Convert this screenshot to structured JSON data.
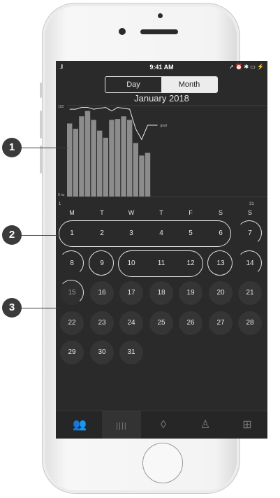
{
  "status": {
    "time": "9:41 AM",
    "signal": "..ll",
    "indicators": "➚ ⏰ ✱ ▭ ⚡"
  },
  "segment": {
    "day": "Day",
    "month": "Month",
    "selected": "Month"
  },
  "month_title": "January 2018",
  "chart_data": {
    "type": "bar",
    "categories": [
      "1",
      "2",
      "3",
      "4",
      "5",
      "6",
      "7",
      "8",
      "9",
      "10",
      "11",
      "12",
      "13",
      "14",
      "15"
    ],
    "values": [
      82,
      76,
      90,
      96,
      86,
      74,
      66,
      86,
      87,
      90,
      86,
      60,
      46,
      49,
      0
    ],
    "goal_line": [
      98,
      98,
      100,
      100,
      98,
      99,
      100,
      96,
      100,
      99,
      98,
      76,
      64,
      80
    ],
    "ylim": [
      0,
      102
    ],
    "ytick_top": "102",
    "ytick_bottom": "0 oz",
    "xtick_first": "1",
    "xtick_last": "31",
    "goal_label": "goal"
  },
  "weekdays": [
    "M",
    "T",
    "W",
    "T",
    "F",
    "S",
    "S"
  ],
  "calendar": [
    [
      "1",
      "2",
      "3",
      "4",
      "5",
      "6",
      "7"
    ],
    [
      "8",
      "9",
      "10",
      "11",
      "12",
      "13",
      "14"
    ],
    [
      "15",
      "16",
      "17",
      "18",
      "19",
      "20",
      "21"
    ],
    [
      "22",
      "23",
      "24",
      "25",
      "26",
      "27",
      "28"
    ],
    [
      "29",
      "30",
      "31"
    ]
  ],
  "callouts": [
    "1",
    "2",
    "3"
  ],
  "tabs": [
    {
      "name": "friends-tab",
      "icon": "people-icon",
      "glyph": "👥"
    },
    {
      "name": "stats-tab",
      "icon": "bar-chart-icon",
      "glyph": "||||"
    },
    {
      "name": "drop-tab",
      "icon": "water-drop-icon",
      "glyph": "◊"
    },
    {
      "name": "profile-tab",
      "icon": "person-icon",
      "glyph": "♙"
    },
    {
      "name": "add-drink-tab",
      "icon": "add-cup-icon",
      "glyph": "⊞"
    }
  ],
  "colors": {
    "screen_bg": "#2a2a2a",
    "bar": "#8c8c8c",
    "text": "#e6e6e6"
  }
}
